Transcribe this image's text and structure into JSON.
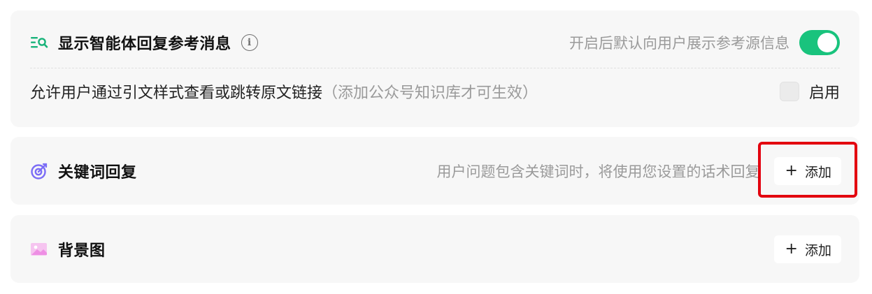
{
  "reference_section": {
    "title": "显示智能体回复参考消息",
    "hint": "开启后默认向用户展示参考源信息",
    "toggle_on": true,
    "toggle_color": "#19c37d",
    "option_text": "允许用户通过引文样式查看或跳转原文链接",
    "option_note": "（添加公众号知识库才可生效）",
    "option_label": "启用",
    "option_checked": false,
    "icon": "list-search-icon",
    "info_icon": "info-icon"
  },
  "keyword_section": {
    "title": "关键词回复",
    "hint": "用户问题包含关键词时，将使用您设置的话术回复",
    "add_label": "添加",
    "icon": "target-icon",
    "icon_color": "#7b6cf6",
    "highlighted": true,
    "highlight_color": "#e3000f"
  },
  "background_section": {
    "title": "背景图",
    "add_label": "添加",
    "icon": "image-icon",
    "icon_color": "#f09ae8"
  }
}
